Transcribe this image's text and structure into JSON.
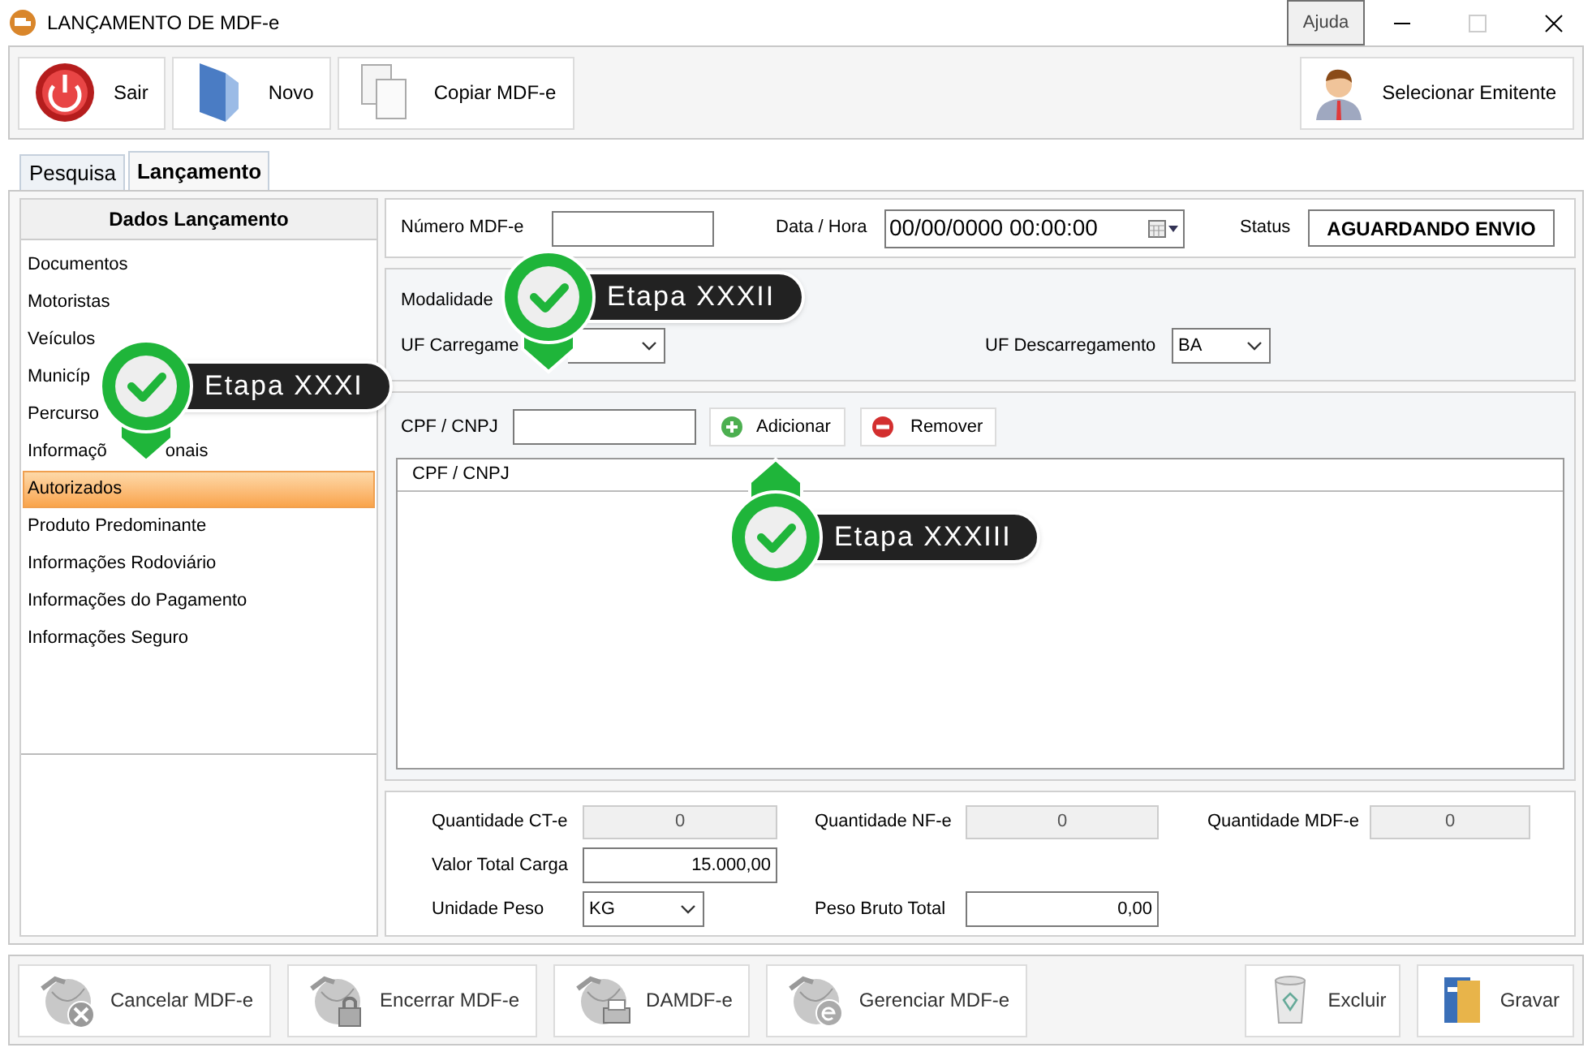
{
  "window": {
    "title": "LANÇAMENTO DE MDF-e",
    "help": "Ajuda"
  },
  "toolbar": [
    {
      "label": "Sair"
    },
    {
      "label": "Novo"
    },
    {
      "label": "Copiar MDF-e"
    }
  ],
  "emitter_button": "Selecionar Emitente",
  "tabs": [
    {
      "label": "Pesquisa",
      "selected": false
    },
    {
      "label": "Lançamento",
      "selected": true
    }
  ],
  "sidebar": {
    "title": "Dados Lançamento",
    "items": [
      {
        "label": "Documentos",
        "selected": false
      },
      {
        "label": "Motoristas",
        "selected": false
      },
      {
        "label": "Veículos",
        "selected": false
      },
      {
        "label": "Municíp",
        "selected": false
      },
      {
        "label": "Percurso",
        "selected": false
      },
      {
        "label": "Informaçõ",
        "tail": "onais",
        "selected": false
      },
      {
        "label": "Autorizados",
        "selected": true
      },
      {
        "label": "Produto Predominante",
        "selected": false
      },
      {
        "label": "Informações Rodoviário",
        "selected": false
      },
      {
        "label": "Informações do Pagamento",
        "selected": false
      },
      {
        "label": "Informações Seguro",
        "selected": false
      }
    ]
  },
  "header": {
    "number_label": "Número MDF-e",
    "date_label": "Data / Hora",
    "date_value": "00/00/0000 00:00:00",
    "status_label": "Status",
    "status_value": "AGUARDANDO ENVIO"
  },
  "route": {
    "mode_label": "Modalidade",
    "uf_load_label": "UF Carregame",
    "uf_unload_label": "UF Descarregamento",
    "uf_unload_value": "BA"
  },
  "authorized": {
    "field_label": "CPF / CNPJ",
    "add_button": "Adicionar",
    "remove_button": "Remover",
    "columns": [
      "CPF / CNPJ"
    ]
  },
  "totals": {
    "cte_label": "Quantidade CT-e",
    "cte_value": "0",
    "nfe_label": "Quantidade NF-e",
    "nfe_value": "0",
    "mdfe_label": "Quantidade MDF-e",
    "mdfe_value": "0",
    "cargo_label": "Valor Total Carga",
    "cargo_value": "15.000,00",
    "unit_label": "Unidade Peso",
    "unit_value": "KG",
    "weight_label": "Peso Bruto Total",
    "weight_value": "0,00"
  },
  "bottom_left": [
    {
      "label": "Cancelar MDF-e"
    },
    {
      "label": "Encerrar MDF-e"
    },
    {
      "label": "DAMDF-e"
    },
    {
      "label": "Gerenciar MDF-e"
    }
  ],
  "bottom_right": [
    {
      "label": "Excluir"
    },
    {
      "label": "Gravar"
    }
  ],
  "callouts": [
    {
      "label": "Etapa XXXI",
      "kind": "down"
    },
    {
      "label": "Etapa XXXII",
      "kind": "down"
    },
    {
      "label": "Etapa XXXIII",
      "kind": "up"
    }
  ]
}
